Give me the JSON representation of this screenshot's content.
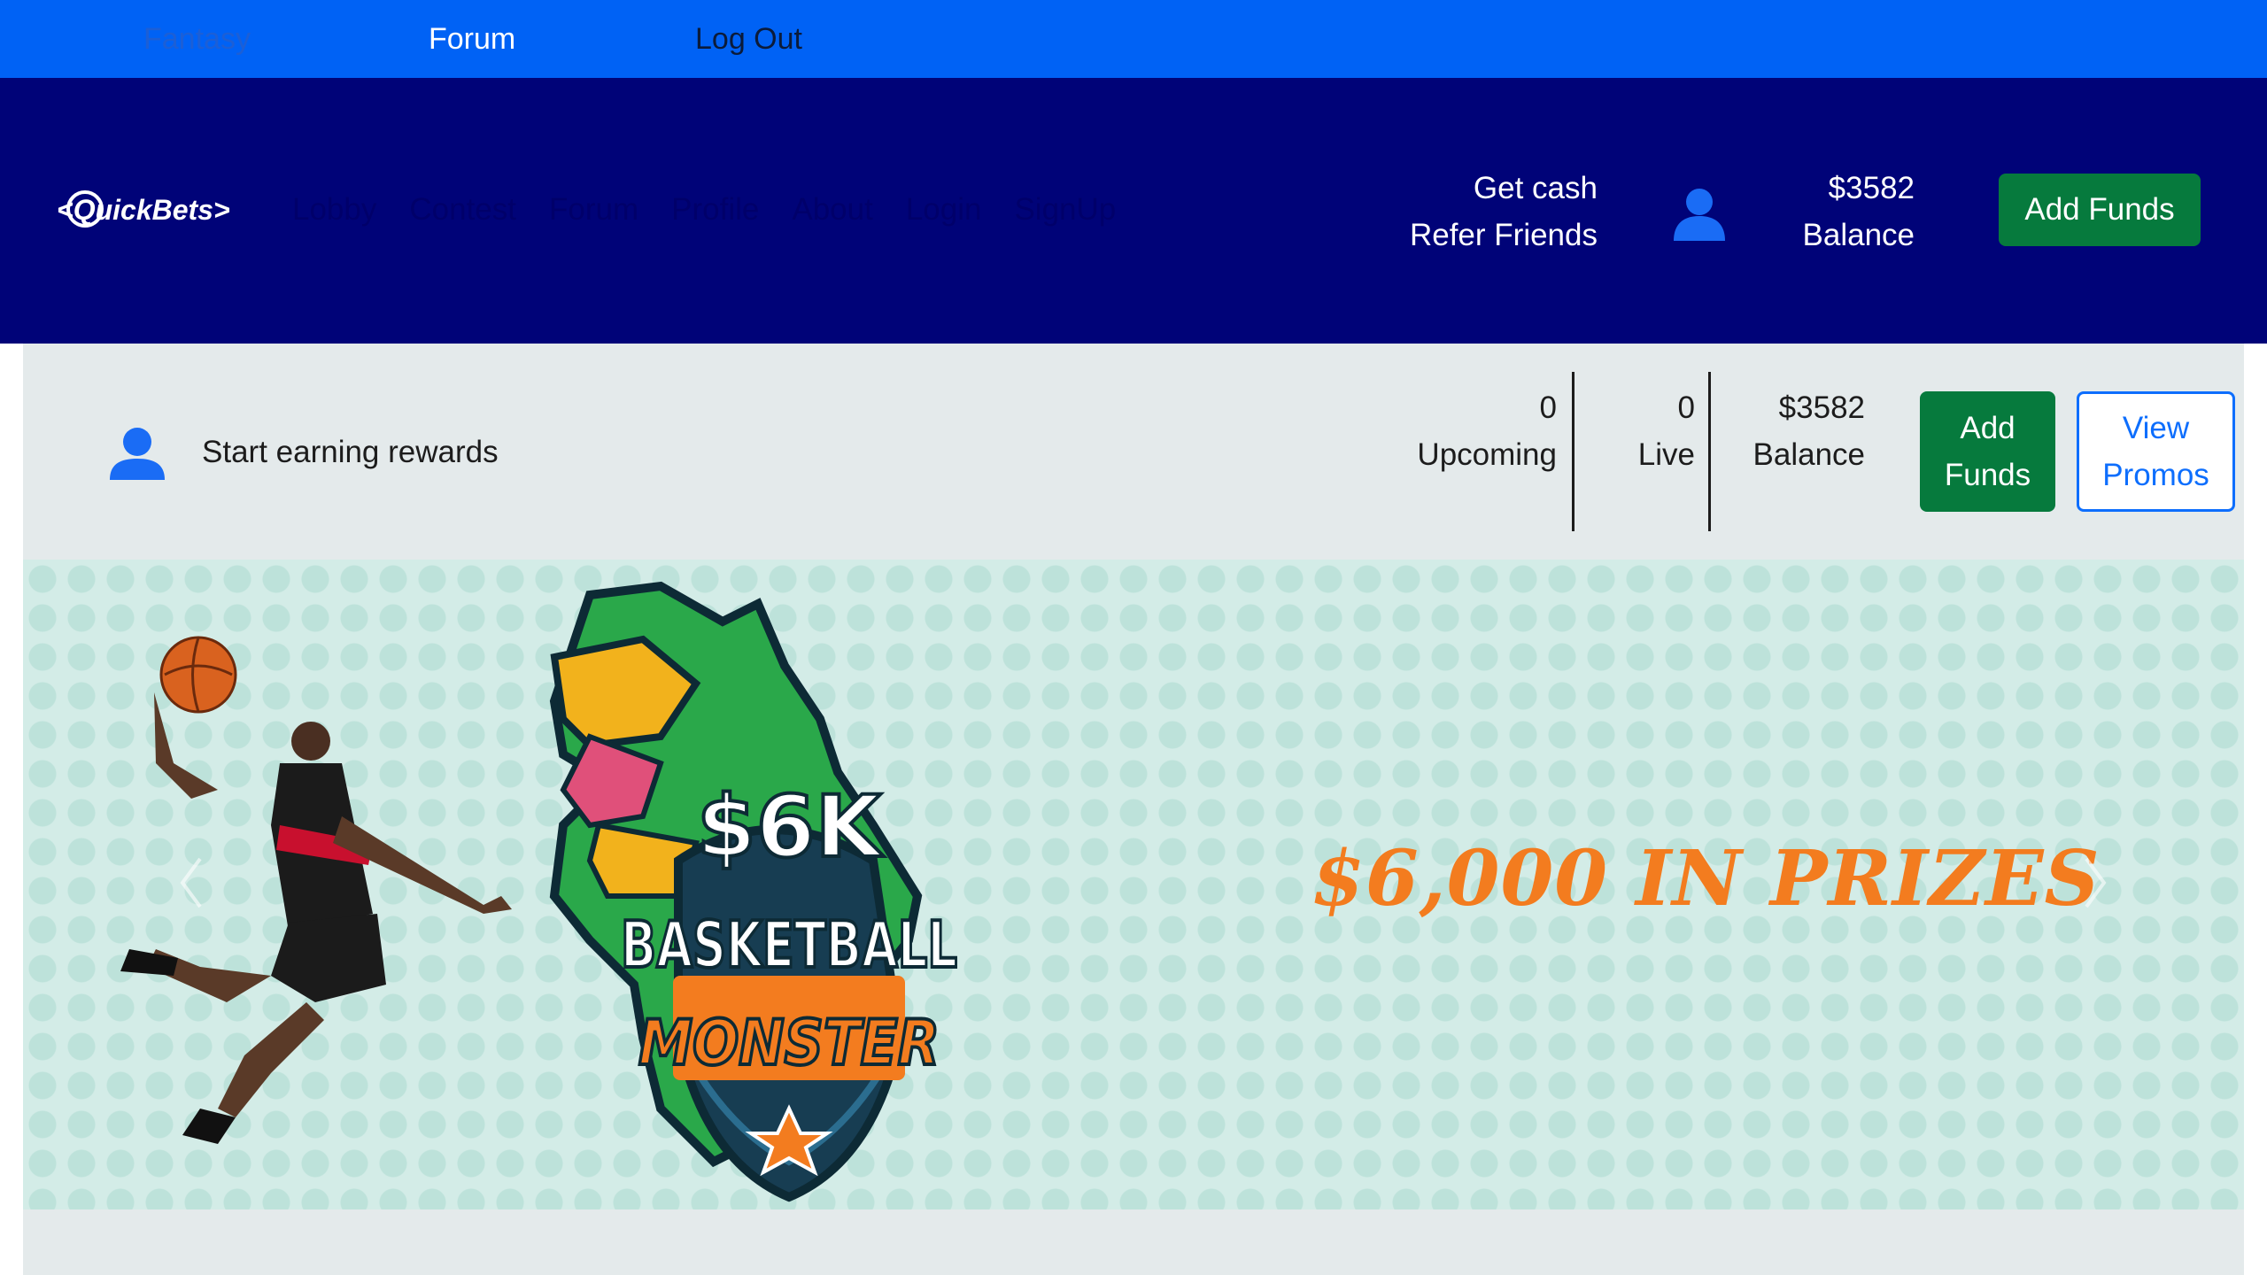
{
  "topbar": {
    "links": [
      "Fantasy",
      "Forum",
      "Log Out"
    ]
  },
  "navbar": {
    "logo_text": "<QuickBets>",
    "links": [
      "Lobby",
      "Contest",
      "Forum",
      "Profile",
      "About",
      "Login",
      "SignUp"
    ],
    "refer_line1": "Get cash",
    "refer_line2": "Refer Friends",
    "user_icon": "user-icon",
    "balance_amount": "$3582",
    "balance_label": "Balance",
    "add_funds_label": "Add Funds"
  },
  "strip": {
    "user_icon": "user-icon",
    "rewards_text": "Start earning rewards",
    "upcoming_count": "0",
    "upcoming_label": "Upcoming",
    "live_count": "0",
    "live_label": "Live",
    "balance_amount": "$3582",
    "balance_label": "Balance",
    "add_funds_line1": "Add",
    "add_funds_line2": "Funds",
    "promos_line1": "View",
    "promos_line2": "Promos"
  },
  "banner": {
    "logo_amount": "$6K",
    "logo_word1": "BASKETBALL",
    "logo_word2": "MONSTER",
    "prize_text": "$6,000 IN PRIZES"
  },
  "colors": {
    "topbar_bg": "#0062f5",
    "navbar_bg": "#000378",
    "success_green": "#067a3d",
    "primary_blue": "#0d6efd",
    "prize_orange": "#f37c1f",
    "strip_bg": "#e4eaeb"
  }
}
